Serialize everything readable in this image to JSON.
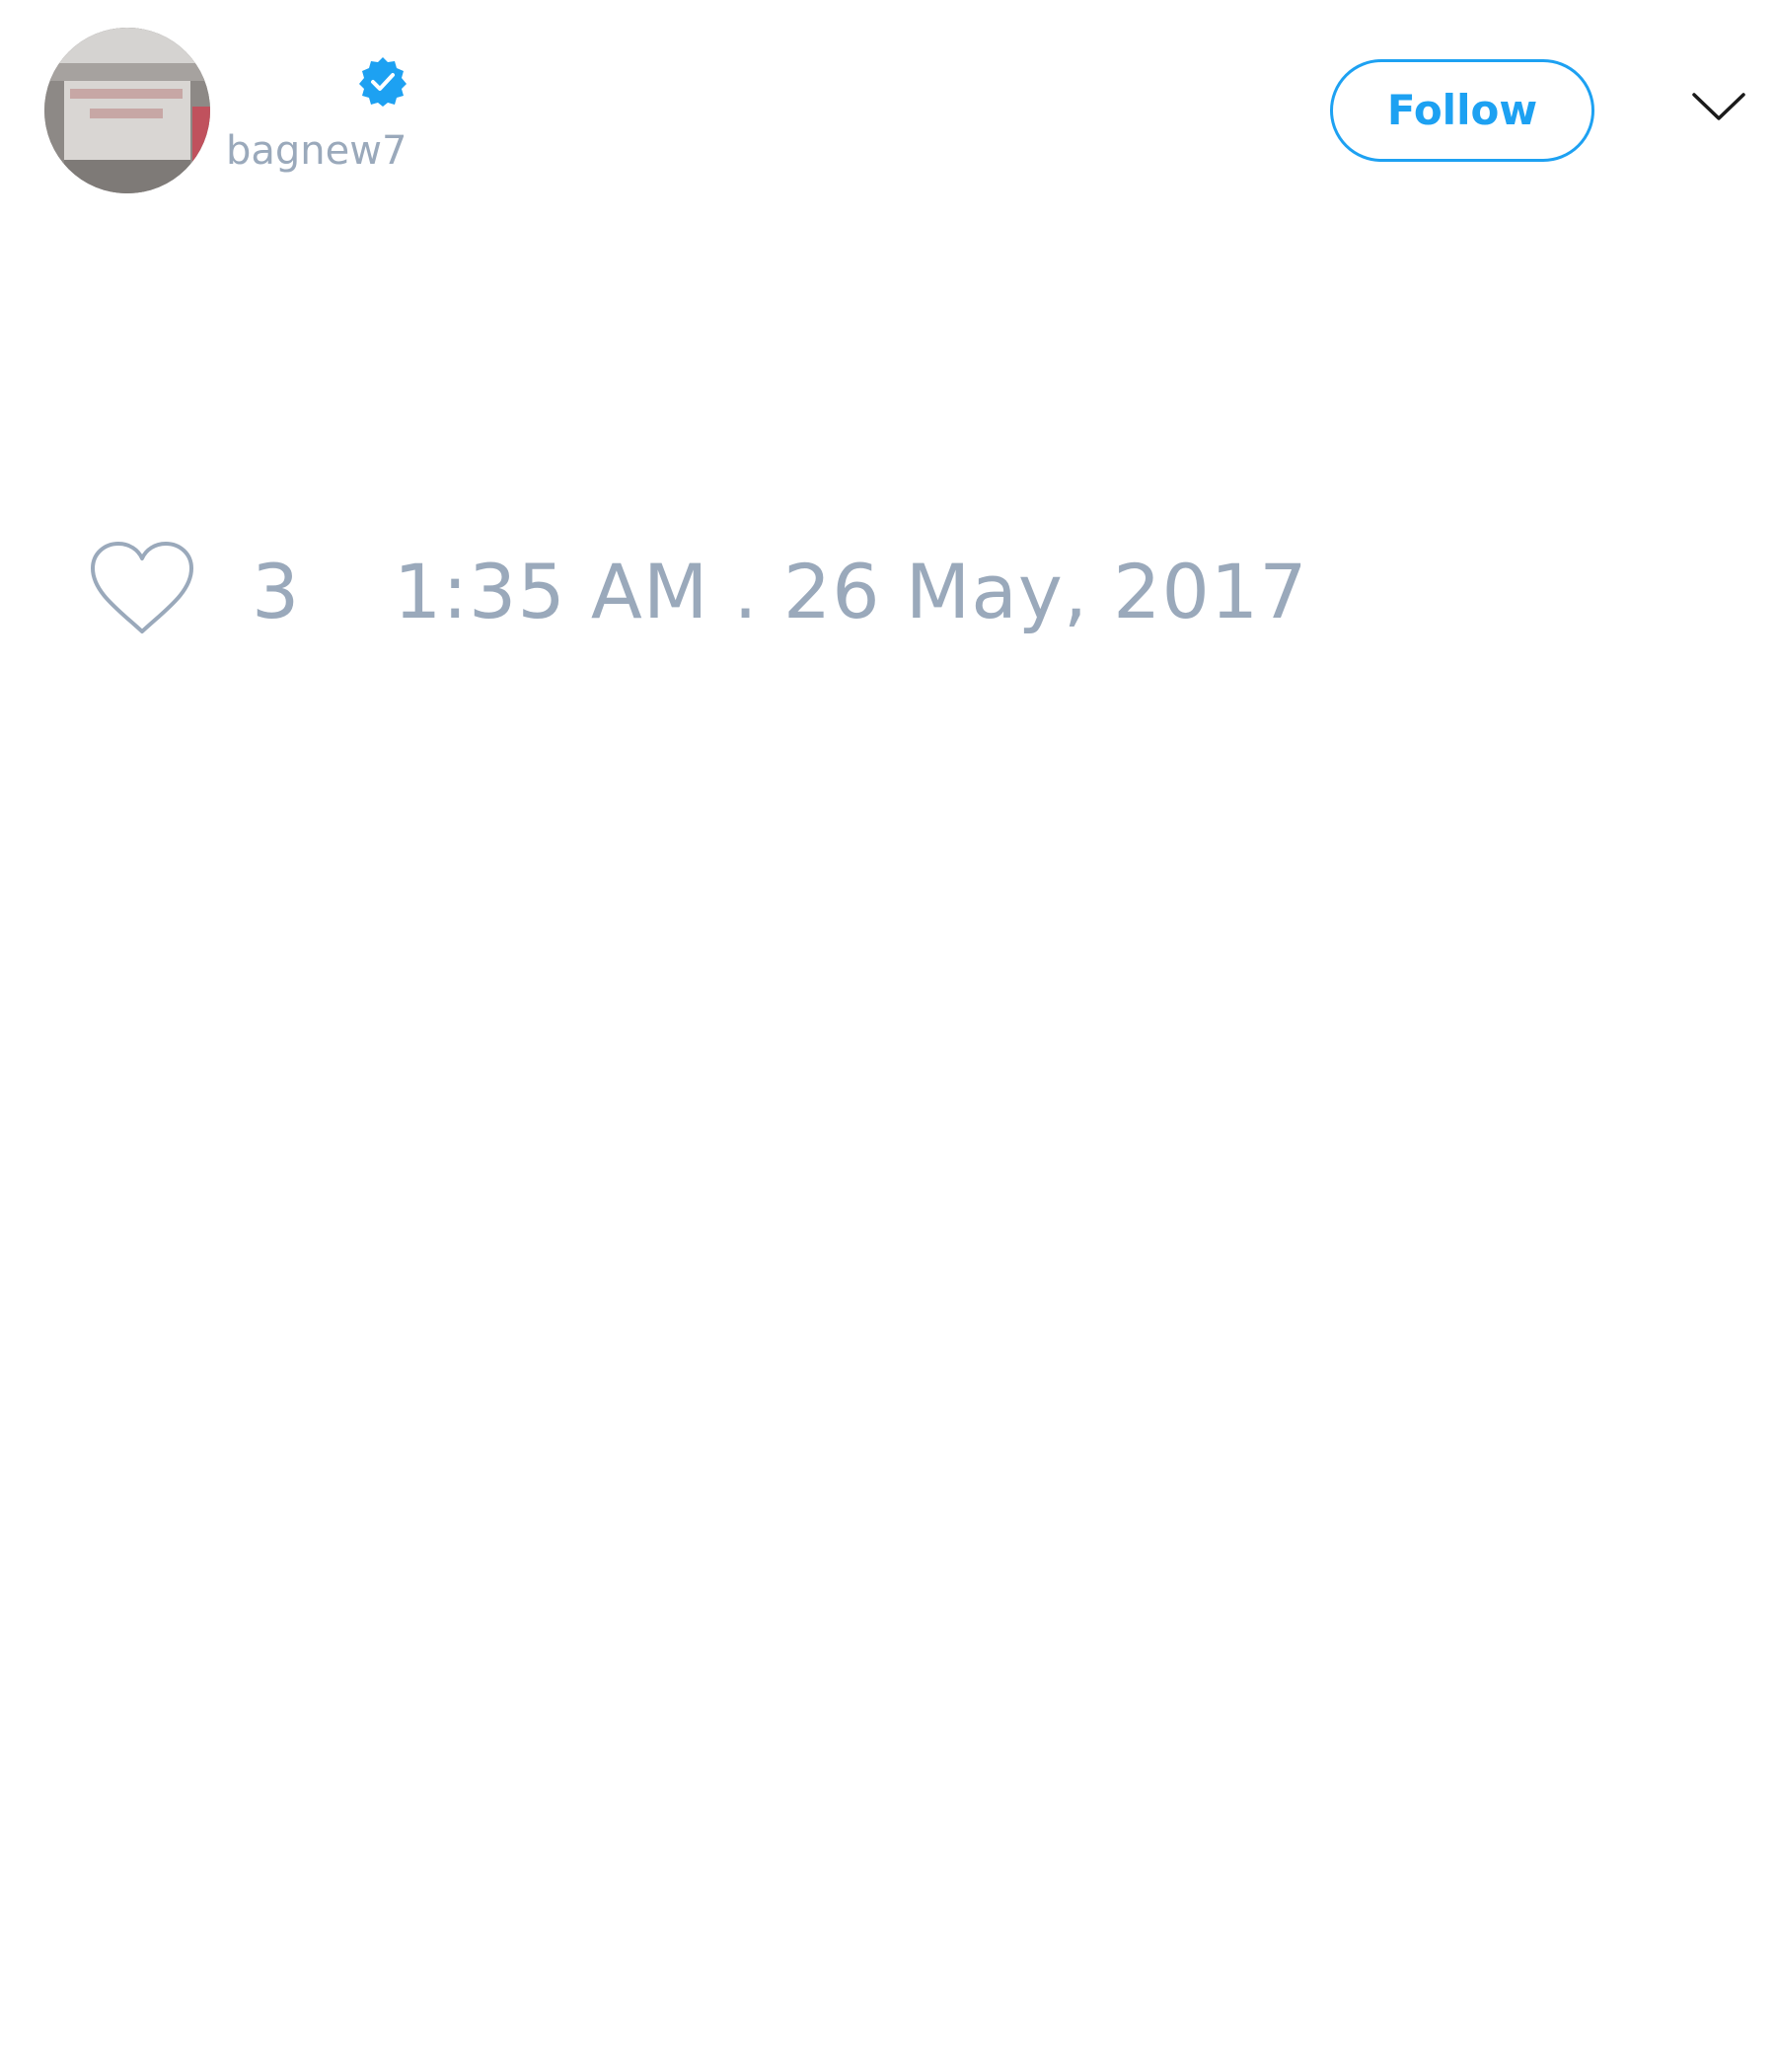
{
  "tweet": {
    "author": {
      "display_name": "",
      "handle": "bagnew7",
      "verified": true,
      "avatar_icon": "avatar-photo-icon"
    },
    "follow_label": "Follow",
    "more_icon": "chevron-down-icon",
    "likes": {
      "icon": "heart-icon",
      "count": "3"
    },
    "timestamp": "1:35 AM . 26 May, 2017"
  },
  "colors": {
    "accent": "#1da1f2",
    "muted_text": "#9aa9bb",
    "background": "#ffffff"
  }
}
